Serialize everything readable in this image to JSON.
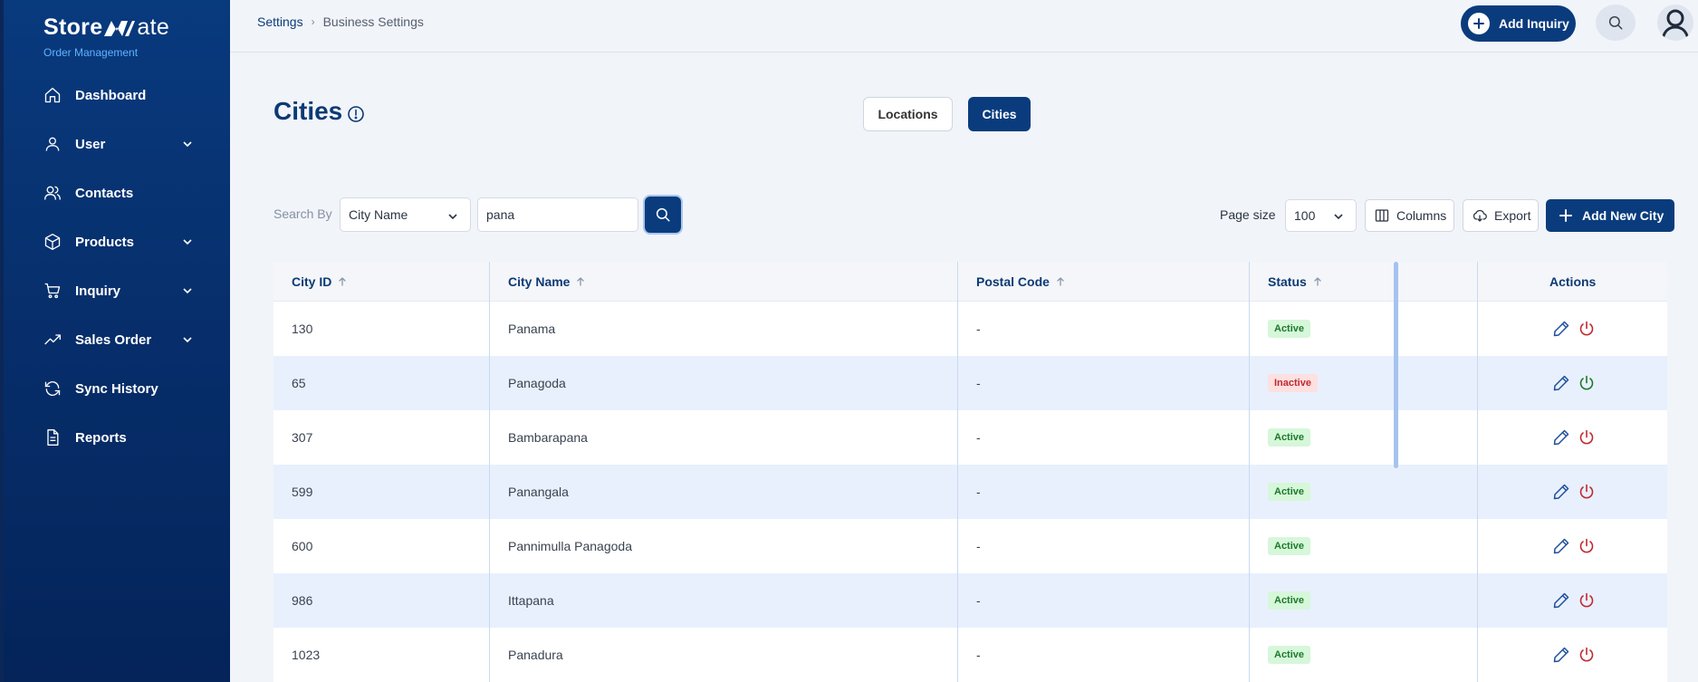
{
  "brand": {
    "name_part1": "Store",
    "name_part2": "ate",
    "subtitle": "Order Management"
  },
  "sidebar": {
    "items": [
      {
        "label": "Dashboard",
        "icon": "home-icon",
        "has_chevron": false
      },
      {
        "label": "User",
        "icon": "user-icon",
        "has_chevron": true
      },
      {
        "label": "Contacts",
        "icon": "users-icon",
        "has_chevron": false
      },
      {
        "label": "Products",
        "icon": "box-icon",
        "has_chevron": true
      },
      {
        "label": "Inquiry",
        "icon": "cart-icon",
        "has_chevron": true
      },
      {
        "label": "Sales Order",
        "icon": "trending-up-icon",
        "has_chevron": true
      },
      {
        "label": "Sync History",
        "icon": "refresh-icon",
        "has_chevron": false
      },
      {
        "label": "Reports",
        "icon": "document-icon",
        "has_chevron": false
      }
    ]
  },
  "header": {
    "breadcrumb": [
      "Settings",
      "Business Settings"
    ],
    "add_inquiry_label": "Add Inquiry"
  },
  "page": {
    "title": "Cities",
    "tabs": [
      {
        "label": "Locations",
        "active": false
      },
      {
        "label": "Cities",
        "active": true
      }
    ]
  },
  "toolbar": {
    "search_by_label": "Search By",
    "search_by_value": "City Name",
    "search_value": "pana",
    "page_size_label": "Page size",
    "page_size_value": "100",
    "columns_label": "Columns",
    "export_label": "Export",
    "add_city_label": "Add New City"
  },
  "table": {
    "columns": [
      "City ID",
      "City Name",
      "Postal Code",
      "Status",
      "Actions"
    ],
    "rows": [
      {
        "id": "130",
        "name": "Panama",
        "postal": "-",
        "status": "Active"
      },
      {
        "id": "65",
        "name": "Panagoda",
        "postal": "-",
        "status": "Inactive"
      },
      {
        "id": "307",
        "name": "Bambarapana",
        "postal": "-",
        "status": "Active"
      },
      {
        "id": "599",
        "name": "Panangala",
        "postal": "-",
        "status": "Active"
      },
      {
        "id": "600",
        "name": "Pannimulla Panagoda",
        "postal": "-",
        "status": "Active"
      },
      {
        "id": "986",
        "name": "Ittapana",
        "postal": "-",
        "status": "Active"
      },
      {
        "id": "1023",
        "name": "Panadura",
        "postal": "-",
        "status": "Active"
      }
    ]
  },
  "colors": {
    "primary": "#0a3c7d",
    "active": "#1c7a2b",
    "inactive": "#c0282f",
    "sidebar": "#072f6c"
  }
}
